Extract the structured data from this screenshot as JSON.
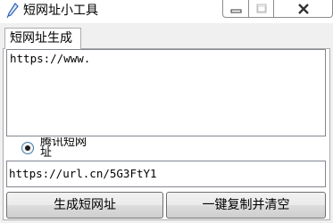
{
  "window": {
    "title": "短网址小工具",
    "icon": "pencil-icon",
    "controls": [
      "minimize-icon",
      "maximize-icon",
      "close-icon"
    ]
  },
  "tabs": [
    {
      "label": "短网址生成",
      "selected": true
    }
  ],
  "input": {
    "value": "https://www."
  },
  "options": {
    "radio_label": "腾讯短网址",
    "selected": true
  },
  "result": {
    "value": "https://url.cn/5G3FtY1"
  },
  "buttons": {
    "generate_label": "生成短网址",
    "copy_clear_label": "一键复制并清空"
  },
  "colors": {
    "window_bg": "#f0f0f0",
    "field_border": "#828790",
    "radio_accent": "#3c7fb1"
  }
}
